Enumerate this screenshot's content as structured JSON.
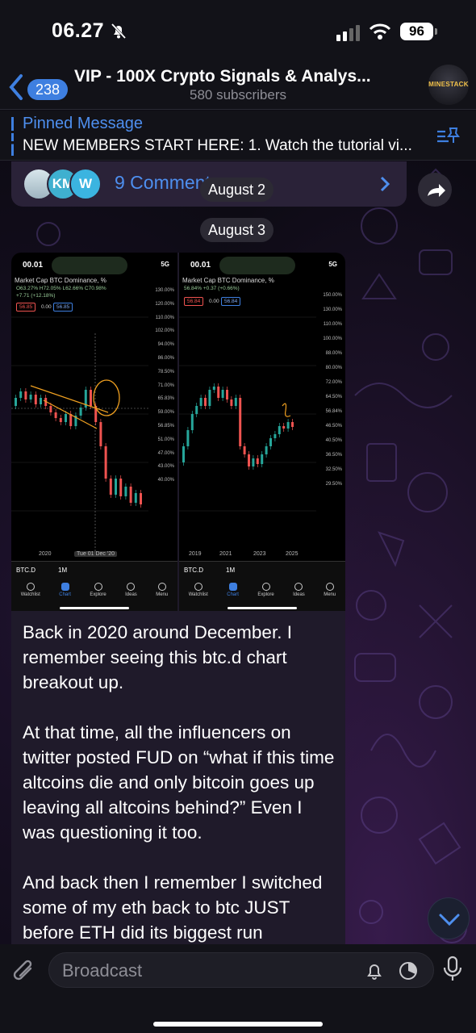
{
  "status_bar": {
    "time": "06.27",
    "battery": "96"
  },
  "header": {
    "back_count": "238",
    "title": "VIP - 100X Crypto Signals & Analys...",
    "subtitle": "580 subscribers",
    "avatar_text": "MINESTACK"
  },
  "pinned": {
    "title": "Pinned Message",
    "text": "NEW MEMBERS START HERE: 1. Watch the tutorial vi..."
  },
  "comments": {
    "label": "9 Comments",
    "avatars": [
      "",
      "KM",
      "W"
    ]
  },
  "dates": [
    "August 2",
    "August 3"
  ],
  "screenshot_left": {
    "time": "00.01",
    "network": "5G",
    "header": "Market Cap BTC Dominance, %",
    "ohlc": "O63.27% H72.05% L62.66% C70.98%",
    "change": "+7.71 (+12.18%)",
    "price_left": "56.85",
    "spread": "0.00",
    "price_right": "56.85",
    "axis": [
      "130.00%",
      "120.00%",
      "110.00%",
      "102.00%",
      "94.00%",
      "86.00%",
      "78.50%",
      "71.00%",
      "65.83%",
      "59.00%",
      "56.85%",
      "51.00%",
      "47.00%",
      "43.00%",
      "40.00%"
    ],
    "years": [
      "2020",
      "Tue 01 Dec '20"
    ],
    "symbol": "BTC.D",
    "timeframe": "1M",
    "tabs": [
      "Watchlist",
      "Chart",
      "Explore",
      "Ideas",
      "Menu"
    ]
  },
  "screenshot_right": {
    "time": "00.01",
    "network": "5G",
    "header": "Market Cap BTC Dominance, %",
    "ohlc": "56.84% +0.37 (+0.66%)",
    "price_left": "56.84",
    "spread": "0.00",
    "price_right": "56.84",
    "axis": [
      "150.00%",
      "130.00%",
      "110.00%",
      "100.00%",
      "88.00%",
      "80.00%",
      "72.00%",
      "64.50%",
      "56.84%",
      "46.50%",
      "40.50%",
      "36.50%",
      "32.50%",
      "29.50%"
    ],
    "years": [
      "2019",
      "2021",
      "2023",
      "2025"
    ],
    "symbol": "BTC.D",
    "timeframe": "1M",
    "tabs": [
      "Watchlist",
      "Chart",
      "Explore",
      "Ideas",
      "Menu"
    ]
  },
  "message": {
    "p1": "Back in 2020 around December. I remember seeing this btc.d chart breakout up.",
    "p2": "At that time, all the influencers on twitter posted FUD on “what if this time altcoins die and only bitcoin goes up leaving all altcoins behind?” Even I was questioning it too.",
    "p3": "And back then I remember I switched some of my eth back to btc JUST before ETH did its biggest run"
  },
  "input": {
    "placeholder": "Broadcast"
  },
  "colors": {
    "accent": "#3e7fe0",
    "bubble": "#1f1a2a",
    "bull": "#26a69a",
    "bear": "#ef5350"
  }
}
